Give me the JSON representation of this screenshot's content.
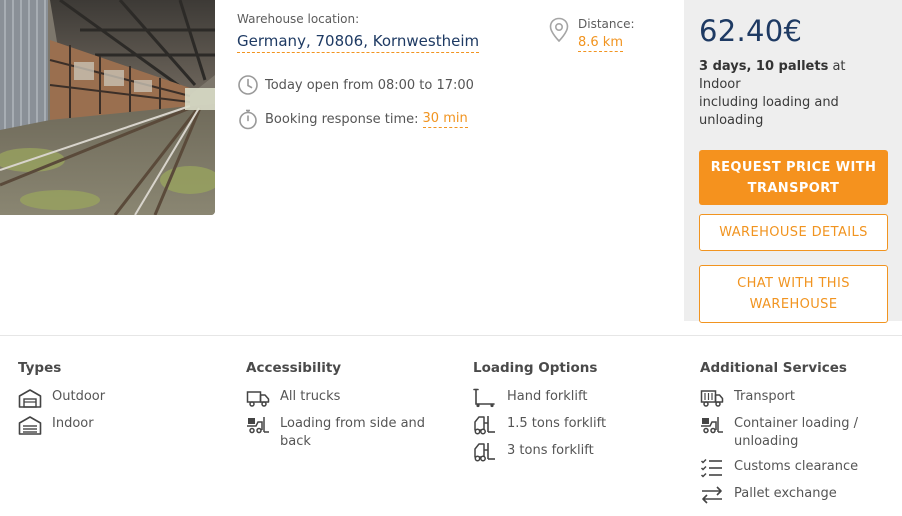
{
  "warehouse": {
    "location_label": "Warehouse location:",
    "location_value": "Germany, 70806, Kornwestheim",
    "hours": "Today open from 08:00 to 17:00",
    "response_label": "Booking response time:",
    "response_value": "30 min",
    "distance_label": "Distance:",
    "distance_value": "8.6 km"
  },
  "price_panel": {
    "price": "62.40€",
    "desc_bold": "3 days, 10 pallets",
    "desc_at": " at ",
    "desc_type": "Indoor",
    "desc_rest": "including loading and unloading",
    "request_button": "REQUEST PRICE WITH TRANSPORT",
    "details_button": "WAREHOUSE DETAILS",
    "chat_button": "CHAT WITH THIS WAREHOUSE"
  },
  "features": {
    "types": {
      "title": "Types",
      "items": [
        {
          "label": "Outdoor",
          "icon": "outdoor-shed-icon"
        },
        {
          "label": "Indoor",
          "icon": "indoor-warehouse-icon"
        }
      ]
    },
    "accessibility": {
      "title": "Accessibility",
      "items": [
        {
          "label": "All trucks",
          "icon": "truck-icon"
        },
        {
          "label": "Loading from side and back",
          "icon": "forklift-loading-icon"
        }
      ]
    },
    "loading_options": {
      "title": "Loading Options",
      "items": [
        {
          "label": "Hand forklift",
          "icon": "hand-forklift-icon"
        },
        {
          "label": "1.5 tons forklift",
          "icon": "forklift-icon"
        },
        {
          "label": "3 tons forklift",
          "icon": "forklift-icon"
        }
      ]
    },
    "additional_services": {
      "title": "Additional Services",
      "items": [
        {
          "label": "Transport",
          "icon": "truck-icon"
        },
        {
          "label": "Container loading / unloading",
          "icon": "forklift-loading-icon"
        },
        {
          "label": "Customs clearance",
          "icon": "checklist-icon"
        },
        {
          "label": "Pallet exchange",
          "icon": "exchange-arrows-icon"
        }
      ]
    }
  },
  "colors": {
    "accent": "#f5921e",
    "navy": "#1e3a63",
    "panel_bg": "#eeeeee"
  }
}
